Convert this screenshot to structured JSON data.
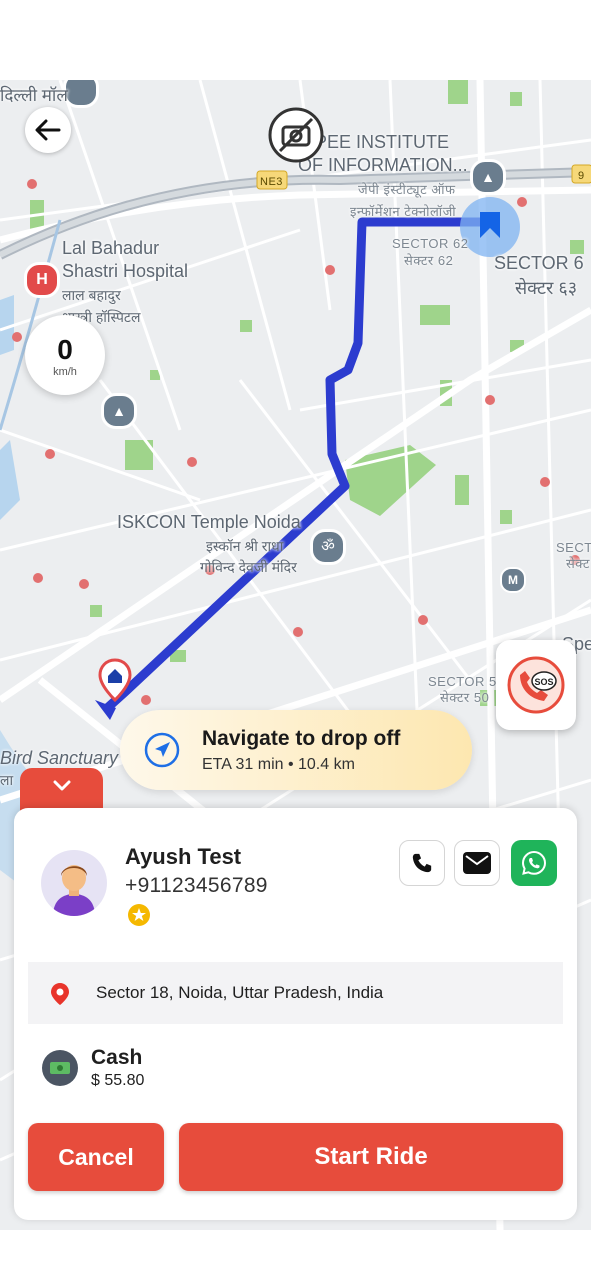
{
  "map": {
    "labels": {
      "mall": "दिल्ली मॉल",
      "jaypee_en_1": "YPEE INSTITUTE",
      "jaypee_en_2": "OF INFORMATION...",
      "jaypee_hi_1": "जेपी इंस्टीट्यूट ऑफ",
      "jaypee_hi_2": "इन्फॉर्मेशन टेक्नोलॉजी",
      "highway": "NE3",
      "highway2": "9",
      "sector62_en": "SECTOR 62",
      "sector62_hi": "सेक्टर 62",
      "sector63_en": "SECTOR 6",
      "sector63_hi": "सेक्टर ६३",
      "hospital_en_1": "Lal Bahadur",
      "hospital_en_2": "Shastri Hospital",
      "hospital_hi_1": "लाल बहादुर",
      "hospital_hi_2": "शास्त्री हॉस्पिटल",
      "iskcon_en": "ISKCON Temple Noida",
      "iskcon_hi_1": "इस्कॉन श्री राधा",
      "iskcon_hi_2": "गोविन्द देवजी मंदिर",
      "sector_right_1": "SECT",
      "sector_right_2": "सेक्ट",
      "sector50_en": "SECTOR 5",
      "sector50_hi": "सेक्टर 50",
      "spe": "Spe",
      "bird": "Bird Sanctuary",
      "bird2": "ला"
    }
  },
  "speedometer": {
    "value": "0",
    "unit": "km/h"
  },
  "navigation": {
    "title": "Navigate to drop off",
    "eta": "ETA 31 min • 10.4 km"
  },
  "rider": {
    "name": "Ayush Test",
    "phone": "+91123456789"
  },
  "dropoff": {
    "address": "Sector 18, Noida, Uttar Pradesh, India"
  },
  "payment": {
    "method": "Cash",
    "amount": "$ 55.80"
  },
  "actions": {
    "cancel": "Cancel",
    "start": "Start Ride"
  },
  "sos": {
    "label": "SOS"
  },
  "colors": {
    "accent": "#e74c3c",
    "route": "#2f3fd1",
    "whatsapp": "#1fb45a",
    "nav_pill": "#fde7b0"
  },
  "icons": [
    "back-arrow-icon",
    "camera-off-icon",
    "hospital-icon",
    "education-icon",
    "temple-icon",
    "metro-icon",
    "home-pin-icon",
    "navigation-arrow-icon",
    "chevron-down-icon",
    "phone-icon",
    "mail-icon",
    "whatsapp-icon",
    "star-icon",
    "location-pin-icon",
    "cash-icon",
    "sos-icon"
  ]
}
